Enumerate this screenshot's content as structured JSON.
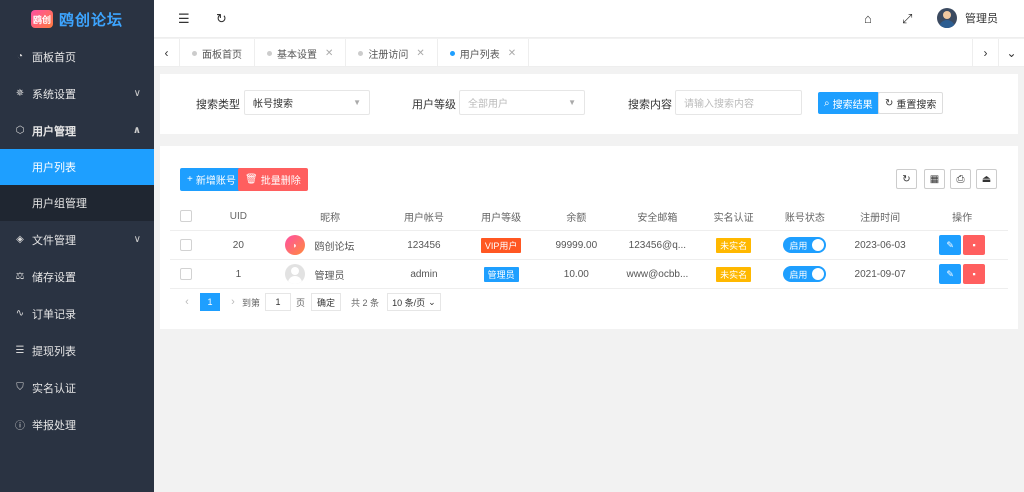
{
  "app": {
    "logo_mark": "鸥创",
    "logo_text": "鸥创论坛"
  },
  "sidebar": {
    "items": [
      {
        "label": "面板首页",
        "icon": "dashboard-icon"
      },
      {
        "label": "系统设置",
        "icon": "gear-icon",
        "arrow": "∨"
      },
      {
        "label": "用户管理",
        "icon": "cube-icon",
        "arrow": "∧"
      },
      {
        "label": "文件管理",
        "icon": "layers-icon",
        "arrow": "∨"
      },
      {
        "label": "储存设置",
        "icon": "storage-icon"
      },
      {
        "label": "订单记录",
        "icon": "pulse-icon"
      },
      {
        "label": "提现列表",
        "icon": "list-icon"
      },
      {
        "label": "实名认证",
        "icon": "shield-icon"
      },
      {
        "label": "举报处理",
        "icon": "info-icon"
      }
    ],
    "submenu": [
      {
        "label": "用户列表"
      },
      {
        "label": "用户组管理"
      }
    ]
  },
  "header": {
    "admin_name": "管理员"
  },
  "tabs": [
    {
      "label": "面板首页"
    },
    {
      "label": "基本设置"
    },
    {
      "label": "注册访问"
    },
    {
      "label": "用户列表"
    }
  ],
  "search": {
    "type_label": "搜索类型",
    "type_value": "帐号搜索",
    "level_label": "用户等级",
    "level_placeholder": "全部用户",
    "content_label": "搜索内容",
    "content_placeholder": "请输入搜索内容",
    "search_btn": "搜索结果",
    "reset_btn": "重置搜索"
  },
  "toolbar": {
    "add_btn": "新增账号",
    "delete_btn": "批量删除"
  },
  "table": {
    "headers": {
      "uid": "UID",
      "nick": "昵称",
      "account": "用户帐号",
      "level": "用户等级",
      "balance": "余额",
      "email": "安全邮箱",
      "realname": "实名认证",
      "status": "账号状态",
      "regtime": "注册时间",
      "op": "操作"
    },
    "rows": [
      {
        "uid": "20",
        "nick": "鸥创论坛",
        "account": "123456",
        "level": "VIP用户",
        "balance": "99999.00",
        "email": "123456@q...",
        "realname": "未实名",
        "status": "启用",
        "regtime": "2023-06-03"
      },
      {
        "uid": "1",
        "nick": "管理员",
        "account": "admin",
        "level": "管理员",
        "balance": "10.00",
        "email": "www@ocbb...",
        "realname": "未实名",
        "status": "启用",
        "regtime": "2021-09-07"
      }
    ]
  },
  "pager": {
    "current": "1",
    "goto_label": "到第",
    "goto_value": "1",
    "page_unit": "页",
    "confirm": "确定",
    "total": "共 2 条",
    "page_size": "10 条/页"
  },
  "colors": {
    "primary": "#1e9fff",
    "danger": "#ff5f5f",
    "vip": "#ff5722",
    "warning": "#ffb800",
    "sidebar_bg": "#2a3342"
  }
}
